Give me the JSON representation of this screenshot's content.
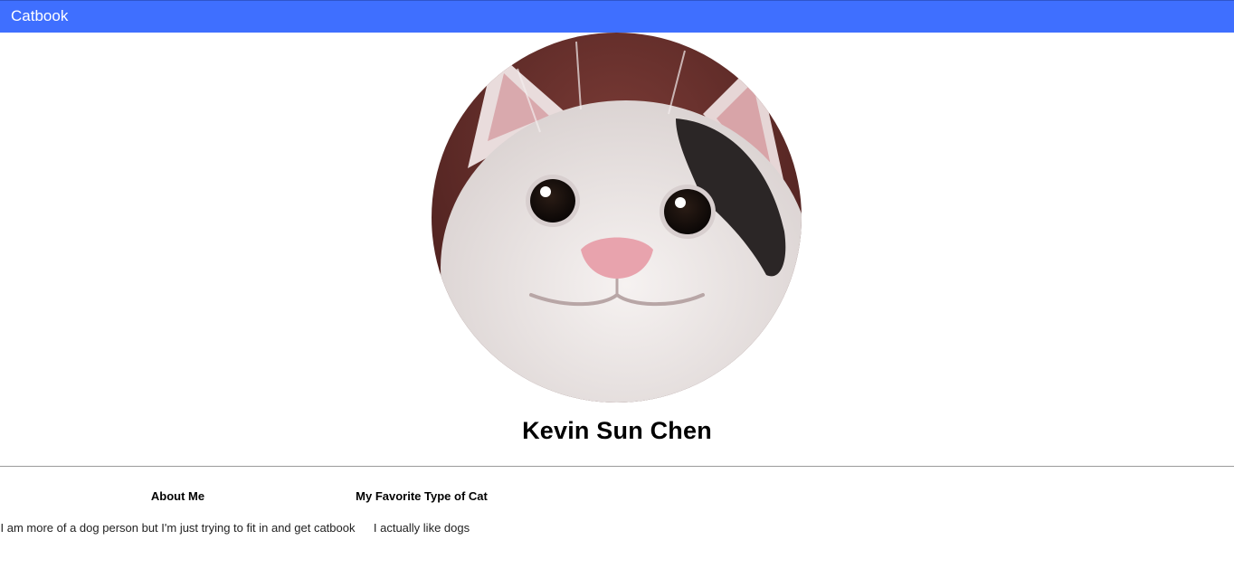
{
  "navbar": {
    "brand": "Catbook",
    "color": "#3f6fff"
  },
  "profile": {
    "avatar_icon": "cat-avatar",
    "name": "Kevin Sun Chen"
  },
  "sections": {
    "about": {
      "heading": "About Me",
      "text": "I am more of a dog person but I'm just trying to fit in and get catbook"
    },
    "favorite_cat": {
      "heading": "My Favorite Type of Cat",
      "text": "I actually like dogs"
    }
  }
}
